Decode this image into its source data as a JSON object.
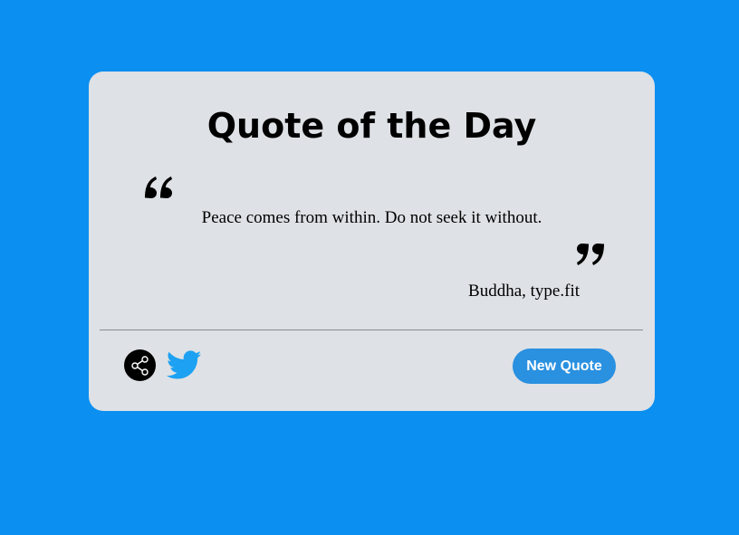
{
  "card": {
    "title": "Quote of the Day",
    "quote": "Peace comes from within. Do not seek it without.",
    "author": "Buddha, type.fit"
  },
  "actions": {
    "share_icon": "share-icon",
    "twitter_icon": "twitter-icon",
    "new_quote_label": "New Quote"
  },
  "colors": {
    "background": "#0b8ff0",
    "card": "#dee1e5",
    "button": "#2a90e0",
    "twitter": "#1da1f2"
  }
}
